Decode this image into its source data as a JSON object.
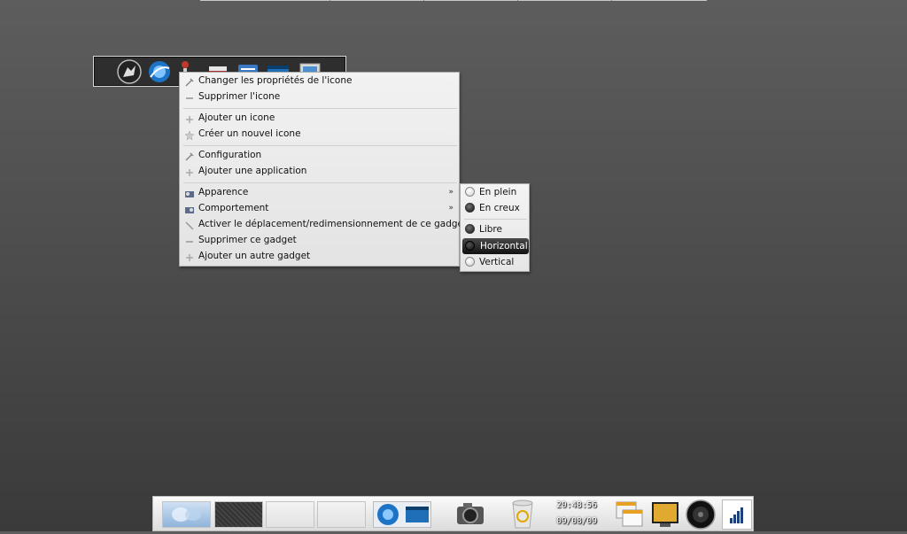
{
  "menu": {
    "items": [
      {
        "label": "Changer les propriétés de l'icone",
        "icon": "wrench-icon"
      },
      {
        "label": "Supprimer l'icone",
        "icon": "remove-icon"
      },
      {
        "label": "Ajouter un icone",
        "icon": "add-icon"
      },
      {
        "label": "Créer un nouvel icone",
        "icon": "star-icon"
      },
      {
        "label": "Configuration",
        "icon": "wrench-icon"
      },
      {
        "label": "Ajouter une application",
        "icon": "add-icon"
      },
      {
        "label": "Apparence",
        "icon": "appearance-icon",
        "submenu": true
      },
      {
        "label": "Comportement",
        "icon": "behavior-icon",
        "submenu": true
      },
      {
        "label": "Activer le déplacement/redimensionnement de ce gadget",
        "icon": "move-icon"
      },
      {
        "label": "Supprimer ce gadget",
        "icon": "remove-icon"
      },
      {
        "label": "Ajouter un autre gadget",
        "icon": "add-icon"
      }
    ],
    "submenu_arrow": "»"
  },
  "submenu": {
    "items": [
      {
        "label": "En plein",
        "checked": false
      },
      {
        "label": "En creux",
        "checked": true
      },
      {
        "label": "Libre",
        "checked": true
      },
      {
        "label": "Horizontal",
        "checked": true,
        "highlighted": true
      },
      {
        "label": "Vertical",
        "checked": false
      }
    ]
  },
  "dock": {
    "time": "20:48:56",
    "date": "09/08/09"
  },
  "colors": {
    "desktop_top": "#5d5d5d",
    "desktop_bottom": "#3a3a3a",
    "menu_bg": "#eeeeee",
    "highlight": "#1a1a1a"
  }
}
